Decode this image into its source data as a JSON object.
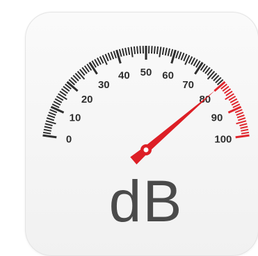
{
  "gauge": {
    "unit": "dB",
    "min": 0,
    "max": 100,
    "reading": 80,
    "labels": [
      "0",
      "10",
      "20",
      "30",
      "40",
      "50",
      "60",
      "70",
      "80",
      "90",
      "100"
    ],
    "red_zone_start": 80,
    "colors": {
      "tick": "#2e2e2e",
      "label": "#2e2e2e",
      "red": "#e0262d",
      "unit_text": "#4a4a4a",
      "needle": "#dd1f26"
    }
  }
}
